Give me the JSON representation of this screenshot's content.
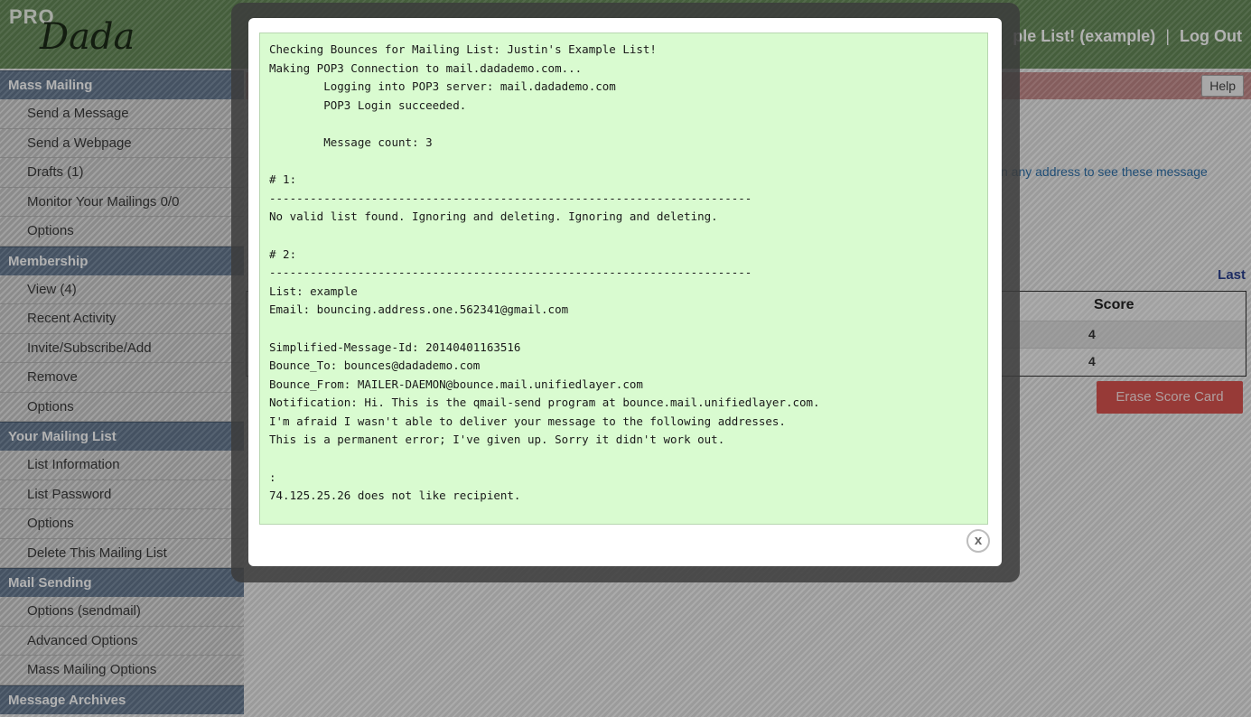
{
  "header": {
    "logo_pro": "PRO",
    "logo_dada": "Dada",
    "list_title": "ple List! (example)",
    "separator": "|",
    "logout_label": "Log Out"
  },
  "sidebar": {
    "sections": [
      {
        "title": "Mass Mailing",
        "items": [
          "Send a Message",
          "Send a Webpage",
          "Drafts (1)",
          "Monitor Your Mailings 0/0",
          "Options"
        ]
      },
      {
        "title": "Membership",
        "items": [
          "View (4)",
          "Recent Activity",
          "Invite/Subscribe/Add",
          "Remove",
          "Options"
        ]
      },
      {
        "title": "Your Mailing List",
        "items": [
          "List Information",
          "List Password",
          "Options",
          "Delete This Mailing List"
        ]
      },
      {
        "title": "Mail Sending",
        "items": [
          "Options (sendmail)",
          "Advanced Options",
          "Mass Mailing Options"
        ]
      },
      {
        "title": "Message Archives",
        "items": []
      }
    ]
  },
  "main": {
    "help_label": "Help",
    "info_text": "n any address to see these message",
    "last_link": "Last",
    "score_header": "Score",
    "scores": [
      "4",
      "4"
    ],
    "erase_label": "Erase Score Card"
  },
  "modal": {
    "log_text": "Checking Bounces for Mailing List: Justin's Example List!\nMaking POP3 Connection to mail.dadademo.com...\n        Logging into POP3 server: mail.dadademo.com\n        POP3 Login succeeded.\n\n        Message count: 3\n\n# 1:\n-----------------------------------------------------------------------\nNo valid list found. Ignoring and deleting. Ignoring and deleting.\n\n# 2:\n-----------------------------------------------------------------------\nList: example\nEmail: bouncing.address.one.562341@gmail.com\n\nSimplified-Message-Id: 20140401163516\nBounce_To: bounces@dadademo.com\nBounce_From: MAILER-DAEMON@bounce.mail.unifiedlayer.com\nNotification: Hi. This is the qmail-send program at bounce.mail.unifiedlayer.com.\nI'm afraid I wasn't able to deliver your message to the following addresses.\nThis is a permanent error; I've given up. Sorry it didn't work out.\n\n:\n74.125.25.26 does not like recipient.",
    "close_label": "x"
  }
}
